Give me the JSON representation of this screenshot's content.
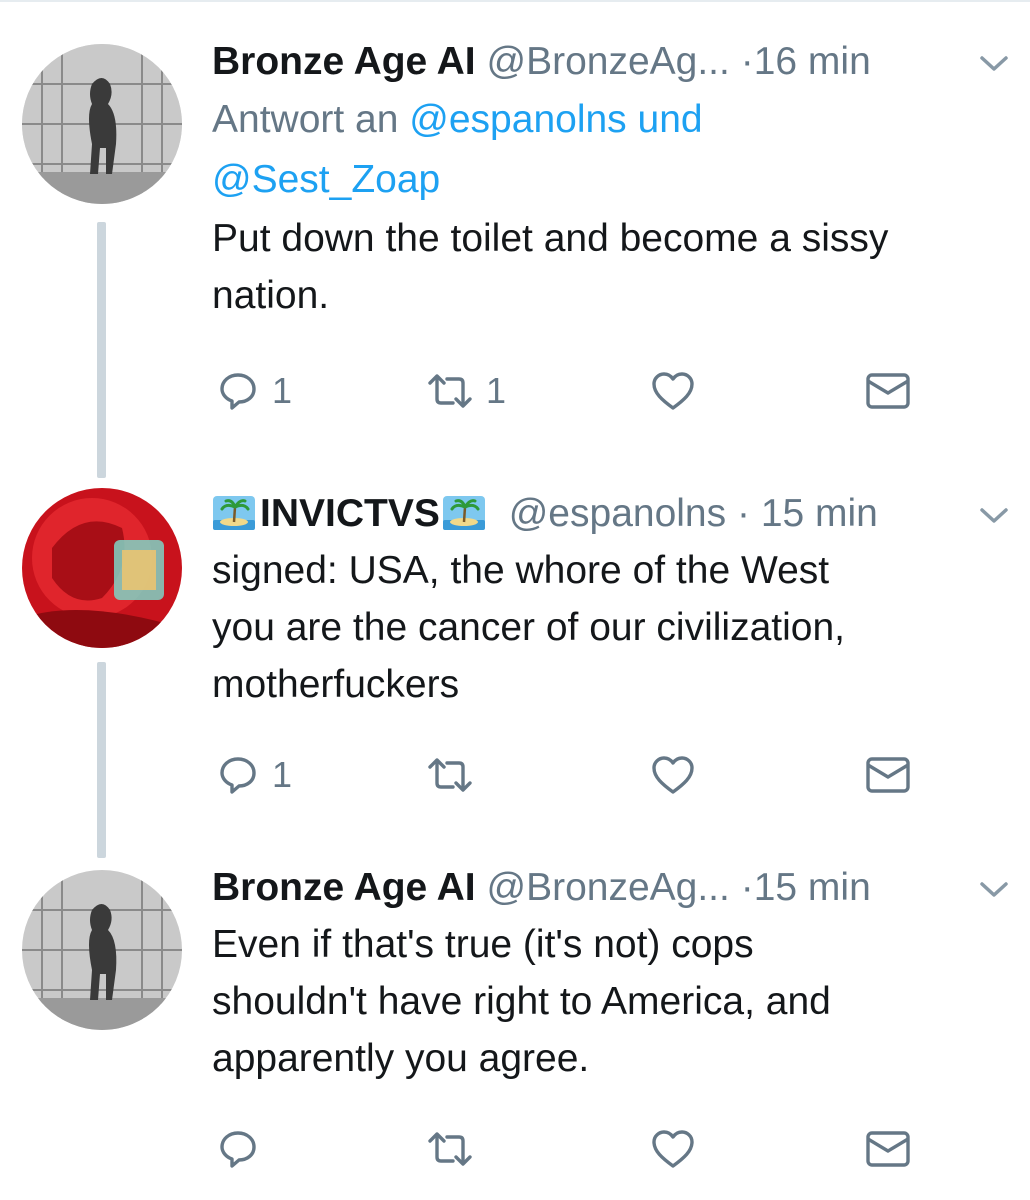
{
  "tweets": [
    {
      "name": "Bronze Age AI",
      "handle": "@BronzeAg...",
      "time": "16 min",
      "reply_prefix": "Antwort an ",
      "reply_mentions": "@espanolns und",
      "reply_mentions_line2": "@Sest_Zoap",
      "text_lines": [
        "Put down the toilet and become a sissy",
        "nation."
      ],
      "actions": {
        "reply_count": "1",
        "retweet_count": "1",
        "like_count": ""
      }
    },
    {
      "name": "INVICTVS",
      "handle": "@espanolns",
      "time": "15 min",
      "name_emoji": "desert-island-icon",
      "text_lines": [
        "signed: USA, the whore of the West",
        "you are the cancer of our civilization,",
        "motherfuckers"
      ],
      "actions": {
        "reply_count": "1",
        "retweet_count": "",
        "like_count": ""
      }
    },
    {
      "name": "Bronze Age AI",
      "handle": "@BronzeAg...",
      "time": "15 min",
      "text_lines": [
        "Even if that's true (it's not) cops",
        "shouldn't have right to America, and",
        "apparently you agree."
      ],
      "actions": {
        "reply_count": "",
        "retweet_count": "",
        "like_count": ""
      }
    }
  ],
  "separator": "·",
  "colors": {
    "text": "#14171a",
    "secondary": "#657786",
    "mention": "#1da1f2",
    "thread_line": "#ccd6dd"
  }
}
